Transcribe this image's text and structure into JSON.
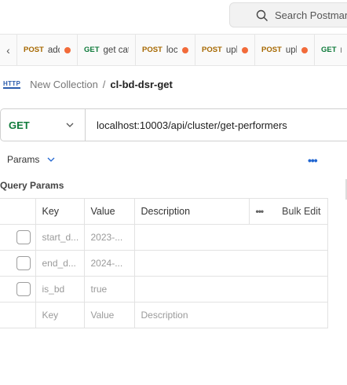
{
  "search": {
    "placeholder": "Search Postman"
  },
  "tabs": [
    {
      "method": "POST",
      "title": "add"
    },
    {
      "method": "GET",
      "title": "get cat"
    },
    {
      "method": "POST",
      "title": "loc"
    },
    {
      "method": "POST",
      "title": "upl"
    },
    {
      "method": "POST",
      "title": "upl"
    },
    {
      "method": "GET",
      "title": "m"
    }
  ],
  "breadcrumb": {
    "badge": "HTTP",
    "collection": "New Collection",
    "separator": "/",
    "request": "cl-bd-dsr-get"
  },
  "request": {
    "method": "GET",
    "url": "localhost:10003/api/cluster/get-performers"
  },
  "params": {
    "label": "Params",
    "section_title": "Query Params",
    "columns": {
      "key": "Key",
      "value": "Value",
      "description": "Description",
      "bulk_edit": "Bulk Edit"
    },
    "rows": [
      {
        "key": "start_d...",
        "value": "2023-...",
        "description": ""
      },
      {
        "key": "end_d...",
        "value": "2024-...",
        "description": ""
      },
      {
        "key": "is_bd",
        "value": "true",
        "description": ""
      }
    ],
    "empty_row": {
      "key": "Key",
      "value": "Value",
      "description": "Description"
    }
  },
  "colors": {
    "get": "#0f7b3b",
    "post": "#a66800",
    "unsaved_dot": "#f26b3a",
    "link": "#2166d1"
  }
}
